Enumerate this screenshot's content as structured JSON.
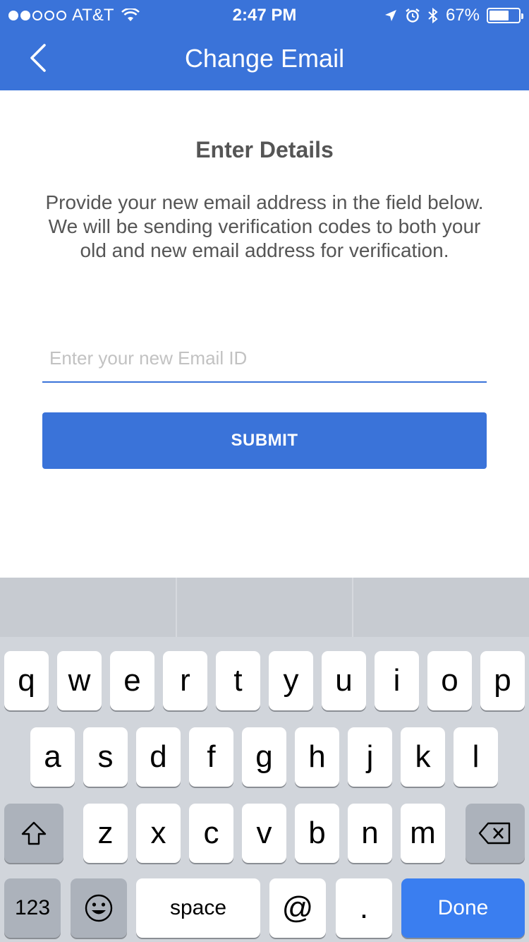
{
  "status_bar": {
    "carrier": "AT&T",
    "time": "2:47 PM",
    "battery": "67%",
    "battery_level": 0.67,
    "signal_bars_filled": 2,
    "signal_bars_total": 5
  },
  "nav": {
    "title": "Change Email",
    "back_icon": "chevron-left-icon"
  },
  "main": {
    "heading": "Enter Details",
    "description": "Provide your new email address in the field below. We will be sending verification codes to both your old and new email address for verification.",
    "email_placeholder": "Enter your new Email ID",
    "email_value": "",
    "submit_label": "SUBMIT"
  },
  "keyboard": {
    "row1": [
      "q",
      "w",
      "e",
      "r",
      "t",
      "y",
      "u",
      "i",
      "o",
      "p"
    ],
    "row2": [
      "a",
      "s",
      "d",
      "f",
      "g",
      "h",
      "j",
      "k",
      "l"
    ],
    "row3": [
      "z",
      "x",
      "c",
      "v",
      "b",
      "n",
      "m"
    ],
    "numbers_label": "123",
    "space_label": "space",
    "at_label": "@",
    "dot_label": ".",
    "done_label": "Done",
    "shift_icon": "shift-icon",
    "backspace_icon": "backspace-icon",
    "emoji_icon": "emoji-icon"
  },
  "colors": {
    "accent": "#3a73d9",
    "done_key": "#3a7ef0",
    "text": "#555555"
  }
}
